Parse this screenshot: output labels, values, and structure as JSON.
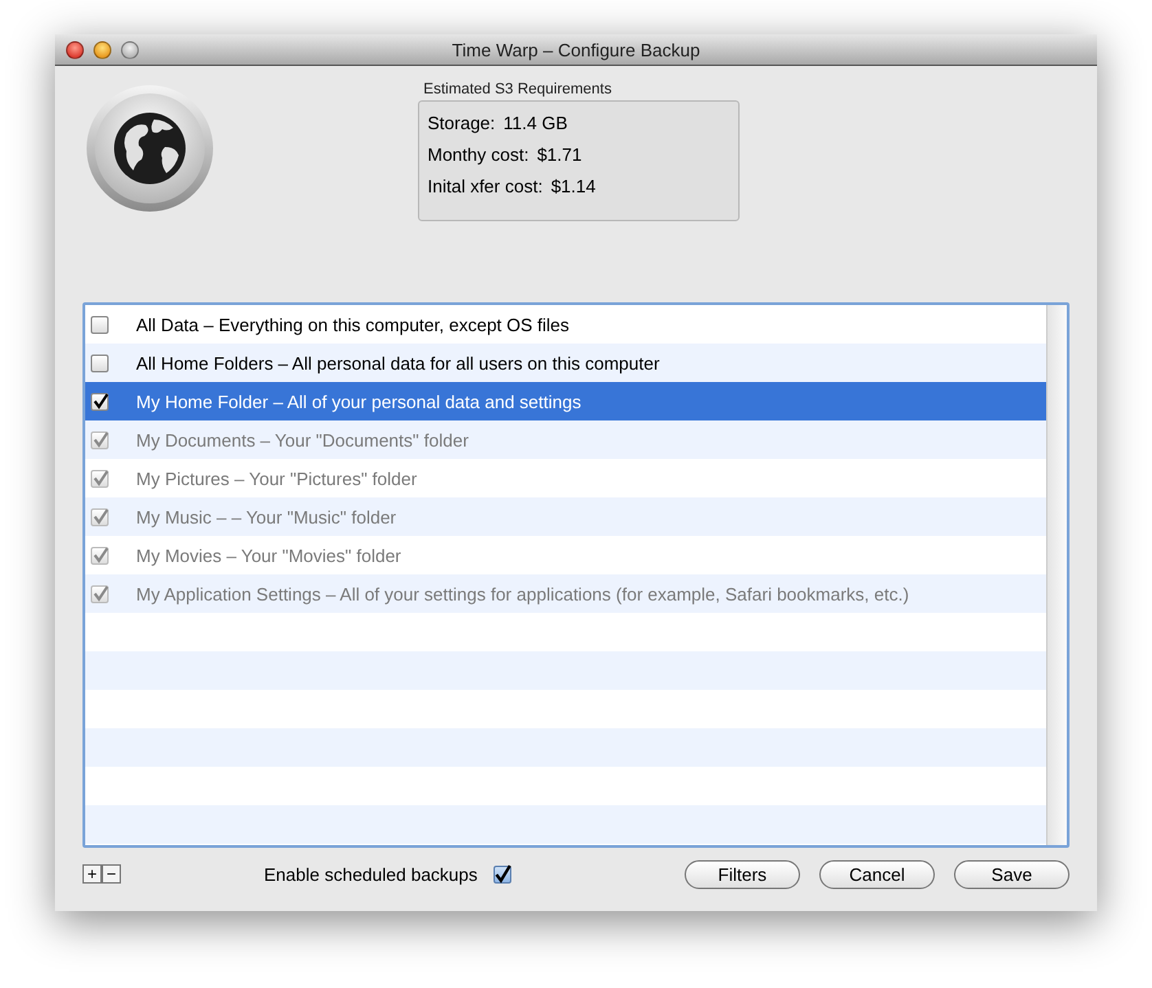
{
  "window": {
    "title": "Time Warp – Configure Backup"
  },
  "requirements": {
    "title": "Estimated S3 Requirements",
    "lines": [
      {
        "label": "Storage:",
        "value": "11.4 GB"
      },
      {
        "label": "Monthy cost:",
        "value": "$1.71"
      },
      {
        "label": "Inital xfer cost:",
        "value": "$1.14"
      }
    ]
  },
  "items": [
    {
      "label": "All Data – Everything on this computer, except OS files",
      "checked": false,
      "disabled": false,
      "selected": false
    },
    {
      "label": "All Home Folders – All personal data for all users on this computer",
      "checked": false,
      "disabled": false,
      "selected": false
    },
    {
      "label": "My Home Folder – All of your personal data and settings",
      "checked": true,
      "disabled": false,
      "selected": true
    },
    {
      "label": "My Documents – Your \"Documents\" folder",
      "checked": true,
      "disabled": true,
      "selected": false
    },
    {
      "label": "My Pictures – Your \"Pictures\" folder",
      "checked": true,
      "disabled": true,
      "selected": false
    },
    {
      "label": "My Music – – Your \"Music\" folder",
      "checked": true,
      "disabled": true,
      "selected": false
    },
    {
      "label": "My Movies – Your \"Movies\" folder",
      "checked": true,
      "disabled": true,
      "selected": false
    },
    {
      "label": "My Application Settings – All of your settings for applications (for example, Safari bookmarks, etc.)",
      "checked": true,
      "disabled": true,
      "selected": false
    }
  ],
  "list_buttons": [
    "+",
    "−"
  ],
  "schedule": {
    "label": "Enable scheduled backups",
    "checked": true
  },
  "buttons": [
    "Filters",
    "Cancel",
    "Save"
  ]
}
